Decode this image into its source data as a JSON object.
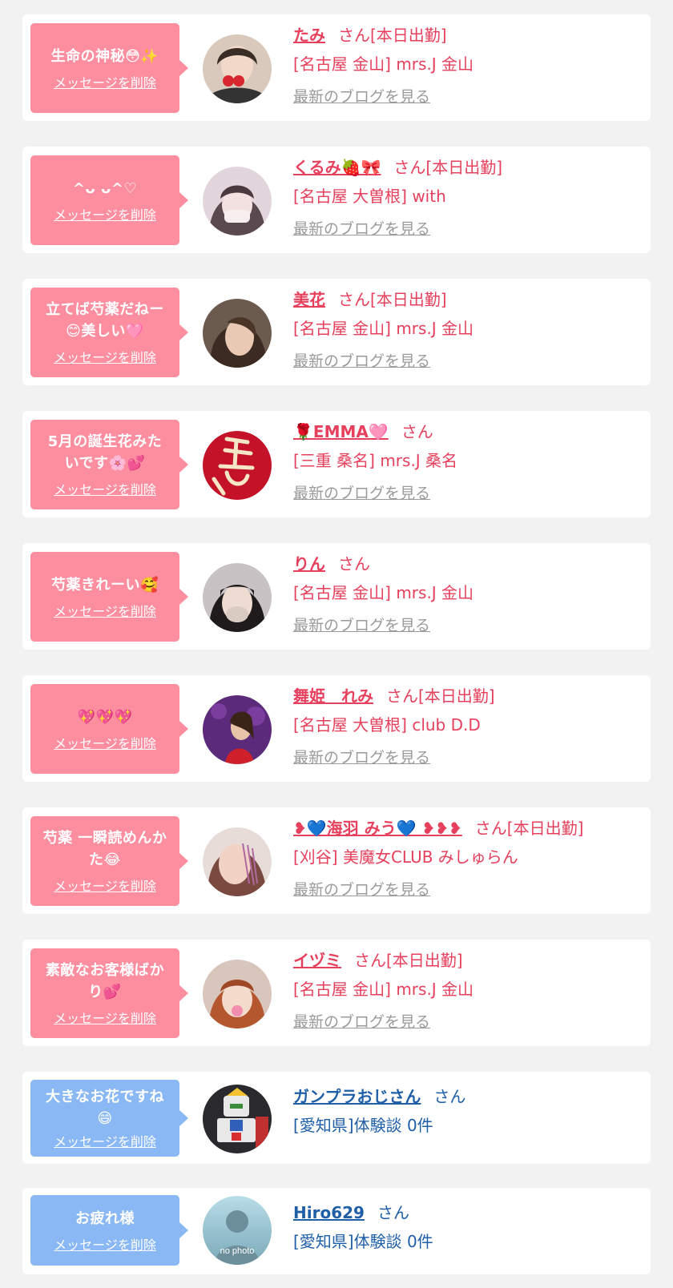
{
  "colors": {
    "page_bg": "#f2f2f2",
    "card_bg": "#ffffff",
    "pink_bubble": "#fc8ea0",
    "blue_bubble": "#8ab8f4",
    "pink_text": "#e6405d",
    "blue_text": "#1f5fa8",
    "blog_link": "#9a9a9a"
  },
  "delete_label": "メッセージを削除",
  "blog_label": "最新のブログを見る",
  "entries": [
    {
      "message": "生命の神秘😳✨",
      "name": "たみ",
      "suffix": "さん[本日出勤]",
      "shop": "[名古屋 金山] mrs.J 金山",
      "avatar": "woman-photo-icon"
    },
    {
      "message": "^ᴗ ᴗ^♡",
      "name": "くるみ🍓🎀",
      "suffix": "さん[本日出勤]",
      "shop": "[名古屋 大曽根] with",
      "avatar": "woman-photo-icon"
    },
    {
      "message": "立てば芍薬だねー\n😊美しい🩷",
      "name": "美花",
      "suffix": "さん[本日出勤]",
      "shop": "[名古屋 金山] mrs.J 金山",
      "avatar": "woman-photo-icon"
    },
    {
      "message": "5月の誕生花みた\nいです🌸💕",
      "name": "🌹EMMA🩷",
      "suffix": "さん",
      "shop": "[三重 桑名] mrs.J 桑名",
      "avatar": "red-calligraphy-photo-icon"
    },
    {
      "message": "芍薬きれーい🥰",
      "name": "りん",
      "suffix": "さん",
      "shop": "[名古屋 金山] mrs.J 金山",
      "avatar": "woman-photo-icon"
    },
    {
      "message": "💖💖💖",
      "name": "舞姫　れみ",
      "suffix": "さん[本日出勤]",
      "shop": "[名古屋 大曽根] club D.D",
      "avatar": "woman-photo-icon"
    },
    {
      "message": "芍薬 一瞬読めんか\nた😂",
      "name": "❥💙海羽 みう💙 ❥❥❥",
      "suffix": "さん[本日出勤]",
      "shop": "[刈谷] 美魔女CLUB みしゅらん",
      "avatar": "woman-photo-icon"
    },
    {
      "message": "素敵なお客様ばか\nり💕",
      "name": "イヅミ",
      "suffix": "さん[本日出勤]",
      "shop": "[名古屋 金山] mrs.J 金山",
      "avatar": "woman-photo-icon"
    },
    {
      "message": "大きなお花ですね\n😄",
      "name": "ガンプラおじさん",
      "suffix": "さん",
      "shop": "[愛知県]体験談 0件",
      "avatar": "robot-model-photo-icon"
    },
    {
      "message": "お疲れ様",
      "name": "Hiro629",
      "suffix": "さん",
      "shop": "[愛知県]体験談 0件",
      "avatar": "no-photo-silhouette-icon",
      "avatar_text": "no photo"
    }
  ]
}
